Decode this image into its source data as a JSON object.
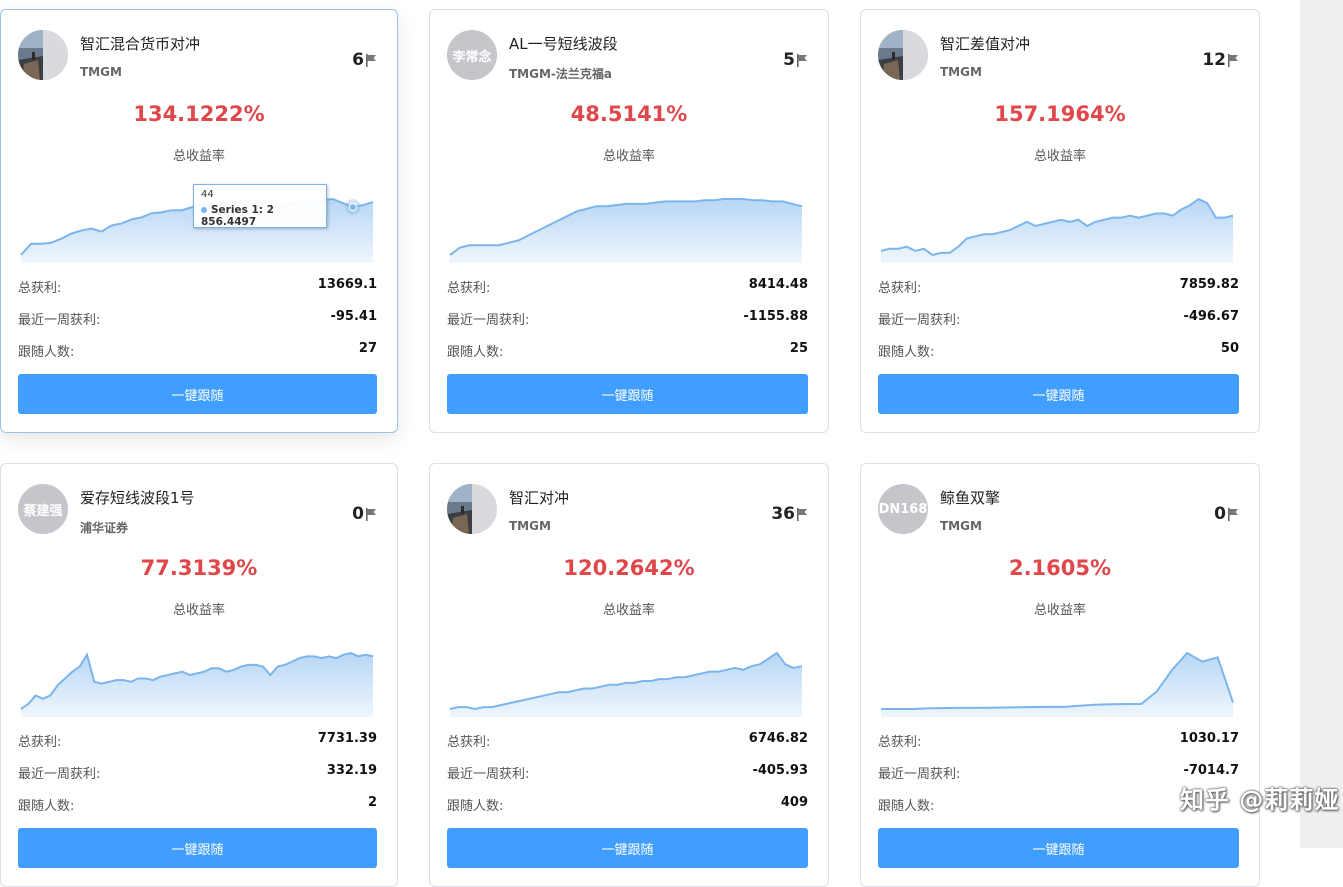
{
  "common": {
    "rate_label": "总收益率",
    "profit_label": "总获利:",
    "week_label": "最近一周获利:",
    "followers_label": "跟随人数:",
    "follow_button": "一键跟随"
  },
  "colors": {
    "rate": "#e0474a",
    "button": "#409eff",
    "line": "#7cb5ec"
  },
  "cards": [
    {
      "name": "智汇混合货币对冲",
      "broker": "TMGM",
      "avatar_text": "",
      "avatar_type": "photo",
      "flags": "6",
      "rate": "134.1222%",
      "total_profit": "13669.1",
      "week_profit": "-95.41",
      "followers": "27",
      "chart_data": {
        "type": "area",
        "values": [
          1,
          12,
          12,
          13,
          17,
          22,
          25,
          27,
          24,
          30,
          32,
          36,
          38,
          42,
          43,
          45,
          45,
          48,
          50,
          50,
          51,
          53,
          52,
          48,
          47,
          49,
          50,
          52,
          53,
          54,
          55,
          56,
          52,
          48,
          50,
          53
        ]
      }
    },
    {
      "name": "AL一号短线波段",
      "broker": "TMGM-法兰克福a",
      "avatar_text": "李常念",
      "avatar_type": "text",
      "flags": "5",
      "rate": "48.5141%",
      "total_profit": "8414.48",
      "week_profit": "-1155.88",
      "followers": "25",
      "chart_data": {
        "type": "area",
        "values": [
          0,
          3,
          4,
          4,
          4,
          4,
          5,
          6,
          8,
          10,
          12,
          14,
          16,
          18,
          19,
          20,
          20,
          20.5,
          21,
          21,
          21,
          21.5,
          22,
          22,
          22,
          22,
          22.5,
          22.5,
          23,
          23,
          23,
          22.5,
          22.5,
          22,
          22,
          21,
          20
        ]
      }
    },
    {
      "name": "智汇差值对冲",
      "broker": "TMGM",
      "avatar_text": "",
      "avatar_type": "photo",
      "flags": "12",
      "rate": "157.1964%",
      "total_profit": "7859.82",
      "week_profit": "-496.67",
      "followers": "50",
      "chart_data": {
        "type": "area",
        "values": [
          10,
          11,
          11,
          12,
          10,
          11,
          8,
          9,
          9,
          12,
          16,
          17,
          18,
          18,
          19,
          20,
          22,
          24,
          22,
          23,
          24,
          25,
          24,
          25,
          22,
          24,
          25,
          26,
          26,
          27,
          26,
          27,
          28,
          28,
          27,
          30,
          32,
          35,
          33,
          26,
          26,
          27
        ]
      }
    },
    {
      "name": "爱存短线波段1号",
      "broker": "浦华证券",
      "avatar_text": "蔡建强",
      "avatar_type": "text",
      "flags": "0",
      "rate": "77.3139%",
      "total_profit": "7731.39",
      "week_profit": "332.19",
      "followers": "2",
      "chart_data": {
        "type": "area",
        "values": [
          0,
          3,
          8,
          6,
          8,
          14,
          18,
          22,
          25,
          32,
          16,
          15,
          16,
          17,
          17,
          16,
          18,
          18,
          17,
          19,
          20,
          21,
          22,
          20,
          21,
          22,
          24,
          24,
          22,
          23,
          25,
          26,
          26,
          25,
          20,
          25,
          26,
          28,
          30,
          31,
          31,
          30,
          31,
          30,
          32,
          33,
          31,
          32,
          31
        ]
      }
    },
    {
      "name": "智汇对冲",
      "broker": "TMGM",
      "avatar_text": "",
      "avatar_type": "photo",
      "flags": "36",
      "rate": "120.2642%",
      "total_profit": "6746.82",
      "week_profit": "-405.93",
      "followers": "409",
      "chart_data": {
        "type": "area",
        "values": [
          0,
          1,
          1,
          0,
          1,
          1,
          2,
          3,
          4,
          5,
          6,
          7,
          8,
          9,
          9,
          10,
          11,
          11,
          12,
          13,
          13,
          14,
          14,
          15,
          15,
          16,
          16,
          17,
          17,
          18,
          19,
          20,
          20,
          21,
          22,
          21,
          23,
          24,
          27,
          30,
          24,
          22,
          23
        ]
      }
    },
    {
      "name": "鲸鱼双擎",
      "broker": "TMGM",
      "avatar_text": "DN168",
      "avatar_type": "text",
      "flags": "0",
      "rate": "2.1605%",
      "total_profit": "1030.17",
      "week_profit": "-7014.7",
      "followers": "",
      "chart_data": {
        "type": "area",
        "values": [
          0,
          0,
          0,
          0.3,
          0.4,
          0.5,
          0.5,
          0.6,
          0.7,
          0.8,
          0.9,
          1,
          1,
          1.5,
          2,
          2.2,
          2.3,
          2.3,
          8,
          18,
          26,
          22,
          24,
          3
        ]
      }
    }
  ],
  "tooltip": {
    "x_label": "44",
    "series_text": "Series 1: 2 856.4497"
  },
  "watermark": "知乎 @莉莉娅"
}
